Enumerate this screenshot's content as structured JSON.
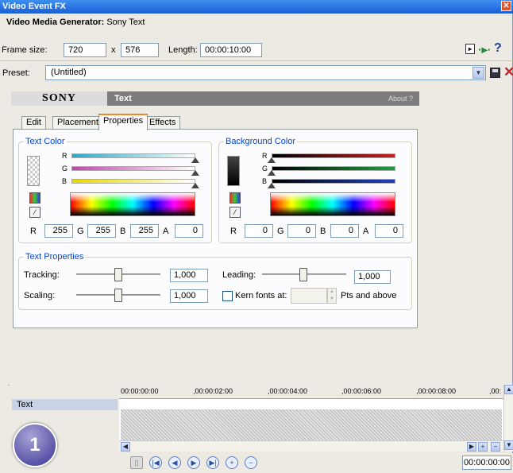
{
  "window": {
    "title": "Video Event FX",
    "close_glyph": "✕"
  },
  "generator": {
    "label": "Video Media Generator:",
    "name": "Sony Text"
  },
  "frame": {
    "size_label": "Frame size:",
    "width": "720",
    "x_label": "x",
    "height": "576",
    "length_label": "Length:",
    "length": "00:00:10:00"
  },
  "toolbar_icons": {
    "plugin_chooser": "plugin-chooser-icon",
    "plugin_chain": "plugin-chain-icon",
    "help": "?"
  },
  "preset": {
    "label": "Preset:",
    "value": "(Untitled)",
    "save_icon": "save-icon",
    "delete_icon": "delete-icon"
  },
  "header": {
    "logo": "SONY",
    "title": "Text",
    "about": "About ?"
  },
  "tabs": [
    {
      "label": "Edit"
    },
    {
      "label": "Placement"
    },
    {
      "label": "Properties",
      "active": true
    },
    {
      "label": "Effects"
    }
  ],
  "text_color": {
    "legend": "Text Color",
    "channels": [
      {
        "label": "R"
      },
      {
        "label": "G"
      },
      {
        "label": "B"
      }
    ],
    "r_label": "R",
    "r": "255",
    "g_label": "G",
    "g": "255",
    "b_label": "B",
    "b": "255",
    "a_label": "A",
    "a": "0"
  },
  "background_color": {
    "legend": "Background Color",
    "channels": [
      {
        "label": "R"
      },
      {
        "label": "G"
      },
      {
        "label": "B"
      }
    ],
    "r_label": "R",
    "r": "0",
    "g_label": "G",
    "g": "0",
    "b_label": "B",
    "b": "0",
    "a_label": "A",
    "a": "0"
  },
  "text_properties": {
    "legend": "Text Properties",
    "tracking_label": "Tracking:",
    "tracking": "1,000",
    "scaling_label": "Scaling:",
    "scaling": "1,000",
    "leading_label": "Leading:",
    "leading": "1,000",
    "kern_label": "Kern fonts at:",
    "kern_value": "",
    "kern_suffix": "Pts and above"
  },
  "timeline": {
    "track_label": "Text",
    "ruler": [
      "00:00:00:00",
      ",00:00:02:00",
      ",00:00:04:00",
      ",00:00:06:00",
      ",00:00:08:00",
      ",00:"
    ],
    "timecode": "00:00:00:00"
  },
  "badge": {
    "number": "1"
  },
  "colors": {
    "title_bar": "#1a5fd6",
    "legend_text": "#0046d5",
    "active_tab_accent": "#e68b2c",
    "header_bar": "#7c7c7c",
    "track_selected": "#c9d3e6",
    "badge": "#5b54a8",
    "delete_x": "#c0282c"
  }
}
